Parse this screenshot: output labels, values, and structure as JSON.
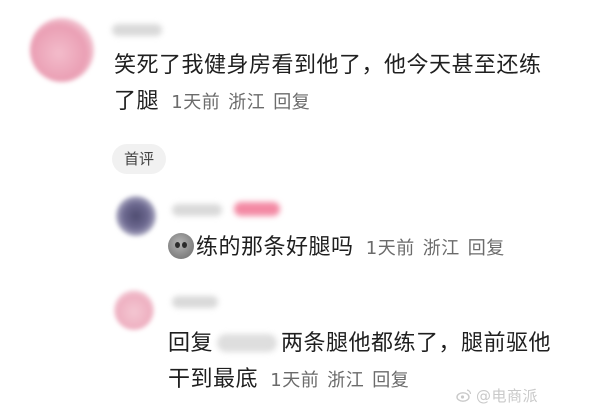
{
  "comments": {
    "top": {
      "text_line1": "笑死了我健身房看到他了，他今天甚至还练",
      "text_line2": "了腿",
      "time": "1天前",
      "location": "浙江",
      "reply_label": "回复"
    },
    "first_comment_tag": "首评",
    "reply1": {
      "text": "练的那条好腿吗",
      "time": "1天前",
      "location": "浙江",
      "reply_label": "回复"
    },
    "reply2": {
      "prefix": "回复",
      "text_after_user": "两条腿他都练了，腿前驱他",
      "text_line2": "干到最底",
      "time": "1天前",
      "location": "浙江",
      "reply_label": "回复"
    }
  },
  "watermark": "@电商派",
  "colors": {
    "meta_gray": "#6b6b6b",
    "pill_bg": "#f1f1f1",
    "badge_pink": "#f38aa4"
  }
}
